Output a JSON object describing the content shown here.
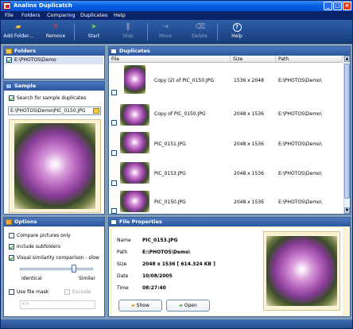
{
  "window": {
    "title": "Analinx Duplicatch"
  },
  "menu": [
    "File",
    "Folders",
    "Comparing",
    "Duplicates",
    "Help"
  ],
  "toolbar": {
    "add_folder": "Add Folder...",
    "remove": "Remove",
    "start": "Start",
    "stop": "Stop",
    "move": "Move",
    "delete": "Delete",
    "help": "Help"
  },
  "folders": {
    "title": "Folders",
    "items": [
      {
        "path": "E:\\PHOTOS\\Demo",
        "checked": true
      }
    ]
  },
  "sample": {
    "title": "Sample",
    "search_label": "Search for sample duplicates",
    "search_checked": true,
    "path_value": "E:\\PHOTOS\\Demo\\PIC_0150.JPG"
  },
  "options": {
    "title": "Options",
    "compare_label": "Compare pictures only",
    "compare_checked": false,
    "subfolders_label": "Include subfolders",
    "subfolders_checked": true,
    "visual_label": "Visual similarity comparison - slow",
    "visual_checked": true,
    "identical_label": "Identical",
    "similar_label": "Similar",
    "slider_level": 0.72,
    "file_mask_label": "Use file mask",
    "file_mask_checked": false,
    "exclude_label": "Exclude",
    "exclude_checked": false,
    "mask_value": "*.*"
  },
  "duplicates": {
    "title": "Duplicates",
    "columns": [
      "File",
      "Size",
      "Path"
    ],
    "rows": [
      {
        "file": "Copy (2) of PIC_0150.JPG",
        "size": "1536 x 2048",
        "path": "E:\\PHOTOS\\Demo\\"
      },
      {
        "file": "Copy of PIC_0150.JPG",
        "size": "2048 x 1536",
        "path": "E:\\PHOTOS\\Demo\\"
      },
      {
        "file": "PIC_0151.JPG",
        "size": "2048 x 1536",
        "path": "E:\\PHOTOS\\Demo\\"
      },
      {
        "file": "PIC_0153.JPG",
        "size": "2048 x 1536",
        "path": "E:\\PHOTOS\\Demo\\"
      },
      {
        "file": "PIC_0150.JPG",
        "size": "2048 x 1536",
        "path": "E:\\PHOTOS\\Demo\\"
      }
    ]
  },
  "properties": {
    "title": "File Properties",
    "name_label": "Name",
    "name_value": "PIC_0153.JPG",
    "path_label": "Path",
    "path_value": "E:\\PHOTOS\\Demo\\",
    "size_label": "Size",
    "size_value": "2048 x 1536  [ 614.324 KB ]",
    "date_label": "Date",
    "date_value": "10/08/2005",
    "time_label": "Time",
    "time_value": "08:27:40",
    "show_label": "Show",
    "open_label": "Open"
  },
  "colors": {
    "accent": "#2a57a0",
    "titlebar": "#0a5fe0"
  }
}
